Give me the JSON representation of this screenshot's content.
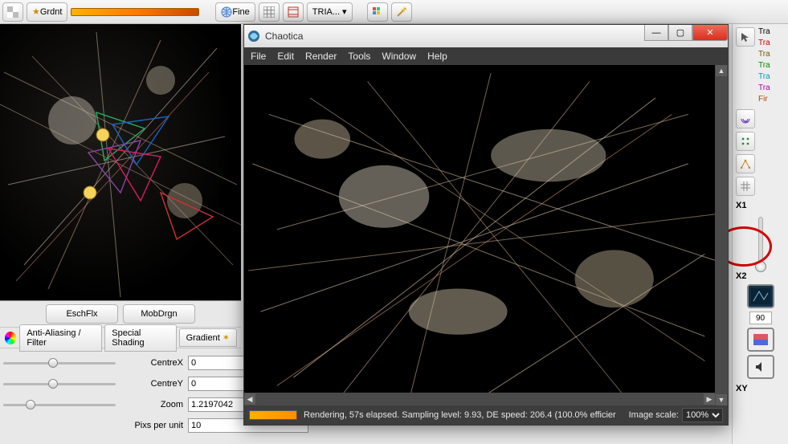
{
  "toolbar": {
    "grdnt_label": "Grdnt",
    "fine_label": "Fine",
    "tria_label": "TRIA...",
    "gradient_colors": [
      "#ffb300",
      "#ff7a00",
      "#c94a00"
    ]
  },
  "editor": {
    "sub_buttons": {
      "eschflx": "EschFlx",
      "mobdrgn": "MobDrgn"
    },
    "tabs": {
      "aaf": "Anti-Aliasing / Filter",
      "shading": "Special Shading",
      "gradient": "Gradient"
    },
    "props": {
      "centrex_label": "CentreX",
      "centrex_value": "0",
      "centrey_label": "CentreY",
      "centrey_value": "0",
      "zoom_label": "Zoom",
      "zoom_value": "1.2197042",
      "ppu_label": "Pixs per unit",
      "ppu_value": "10"
    }
  },
  "rail": {
    "labels": [
      "Tra",
      "Tra",
      "Tra",
      "Tra",
      "Tra",
      "Tra",
      "Fir"
    ],
    "label_colors": [
      "#000",
      "#c00",
      "#7a5700",
      "#008a00",
      "#0098c0",
      "#b200b2",
      "#b24600"
    ],
    "x1": "X1",
    "x2": "X2",
    "xy": "XY",
    "angle_value": "90"
  },
  "chaotica": {
    "title": "Chaotica",
    "menu": [
      "File",
      "Edit",
      "Render",
      "Tools",
      "Window",
      "Help"
    ],
    "status_text": "Rendering, 57s elapsed. Sampling level: 9.93, DE speed: 206.4 (100.0% efficier",
    "scale_label": "Image scale:",
    "scale_value": "100%"
  },
  "chart_data": null
}
